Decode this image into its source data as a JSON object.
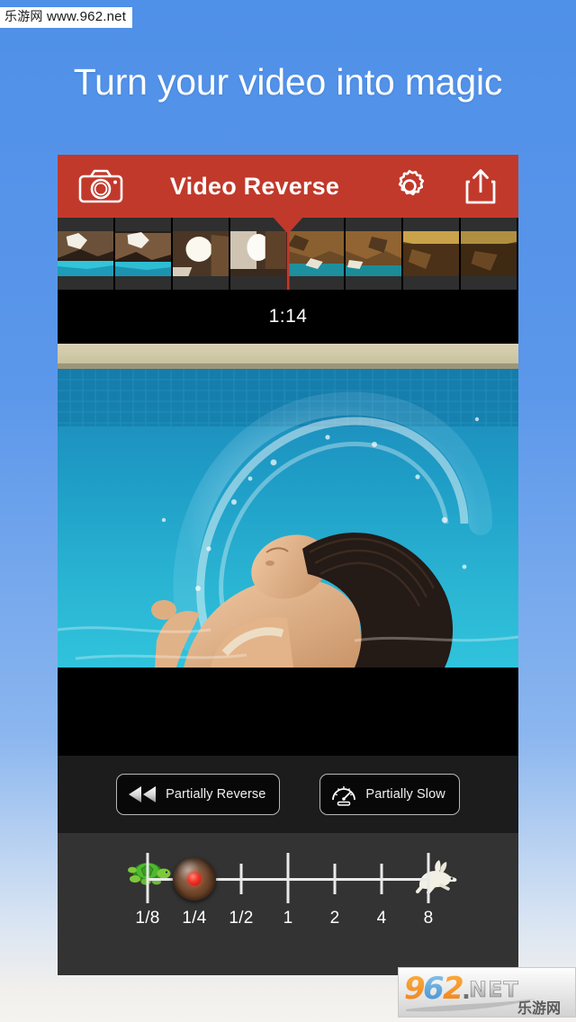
{
  "watermarks": {
    "top": {
      "site_cn": "乐游网",
      "site_url": "www.962.net"
    },
    "bottom": {
      "brand": "962",
      "tld": ".NET",
      "site_cn": "乐游网"
    }
  },
  "promo": {
    "tagline": "Turn your video into magic"
  },
  "app": {
    "header": {
      "title": "Video Reverse",
      "camera_icon": "camera-icon",
      "gear_icon": "gear-icon",
      "share_icon": "share-icon",
      "background_color": "#c1392b"
    },
    "timeline": {
      "current_time": "1:14",
      "playhead_position_percent": 50,
      "frames": 8
    },
    "actions": [
      {
        "label": "Partially Reverse",
        "icon": "rewind-icon"
      },
      {
        "label": "Partially Slow",
        "icon": "speedometer-icon"
      }
    ],
    "speed_slider": {
      "slow_icon": "turtle-icon",
      "fast_icon": "rabbit-icon",
      "selected_value": "1/4",
      "ticks": [
        {
          "label": "1/8",
          "size": "major"
        },
        {
          "label": "1/4",
          "size": "minor"
        },
        {
          "label": "1/2",
          "size": "minor"
        },
        {
          "label": "1",
          "size": "major"
        },
        {
          "label": "2",
          "size": "minor"
        },
        {
          "label": "4",
          "size": "minor"
        },
        {
          "label": "8",
          "size": "major"
        }
      ]
    }
  },
  "colors": {
    "accent_red": "#c1392b",
    "page_blue": "#4f90e8",
    "panel_dark": "#1c1c1c",
    "slider_panel": "#333333"
  }
}
